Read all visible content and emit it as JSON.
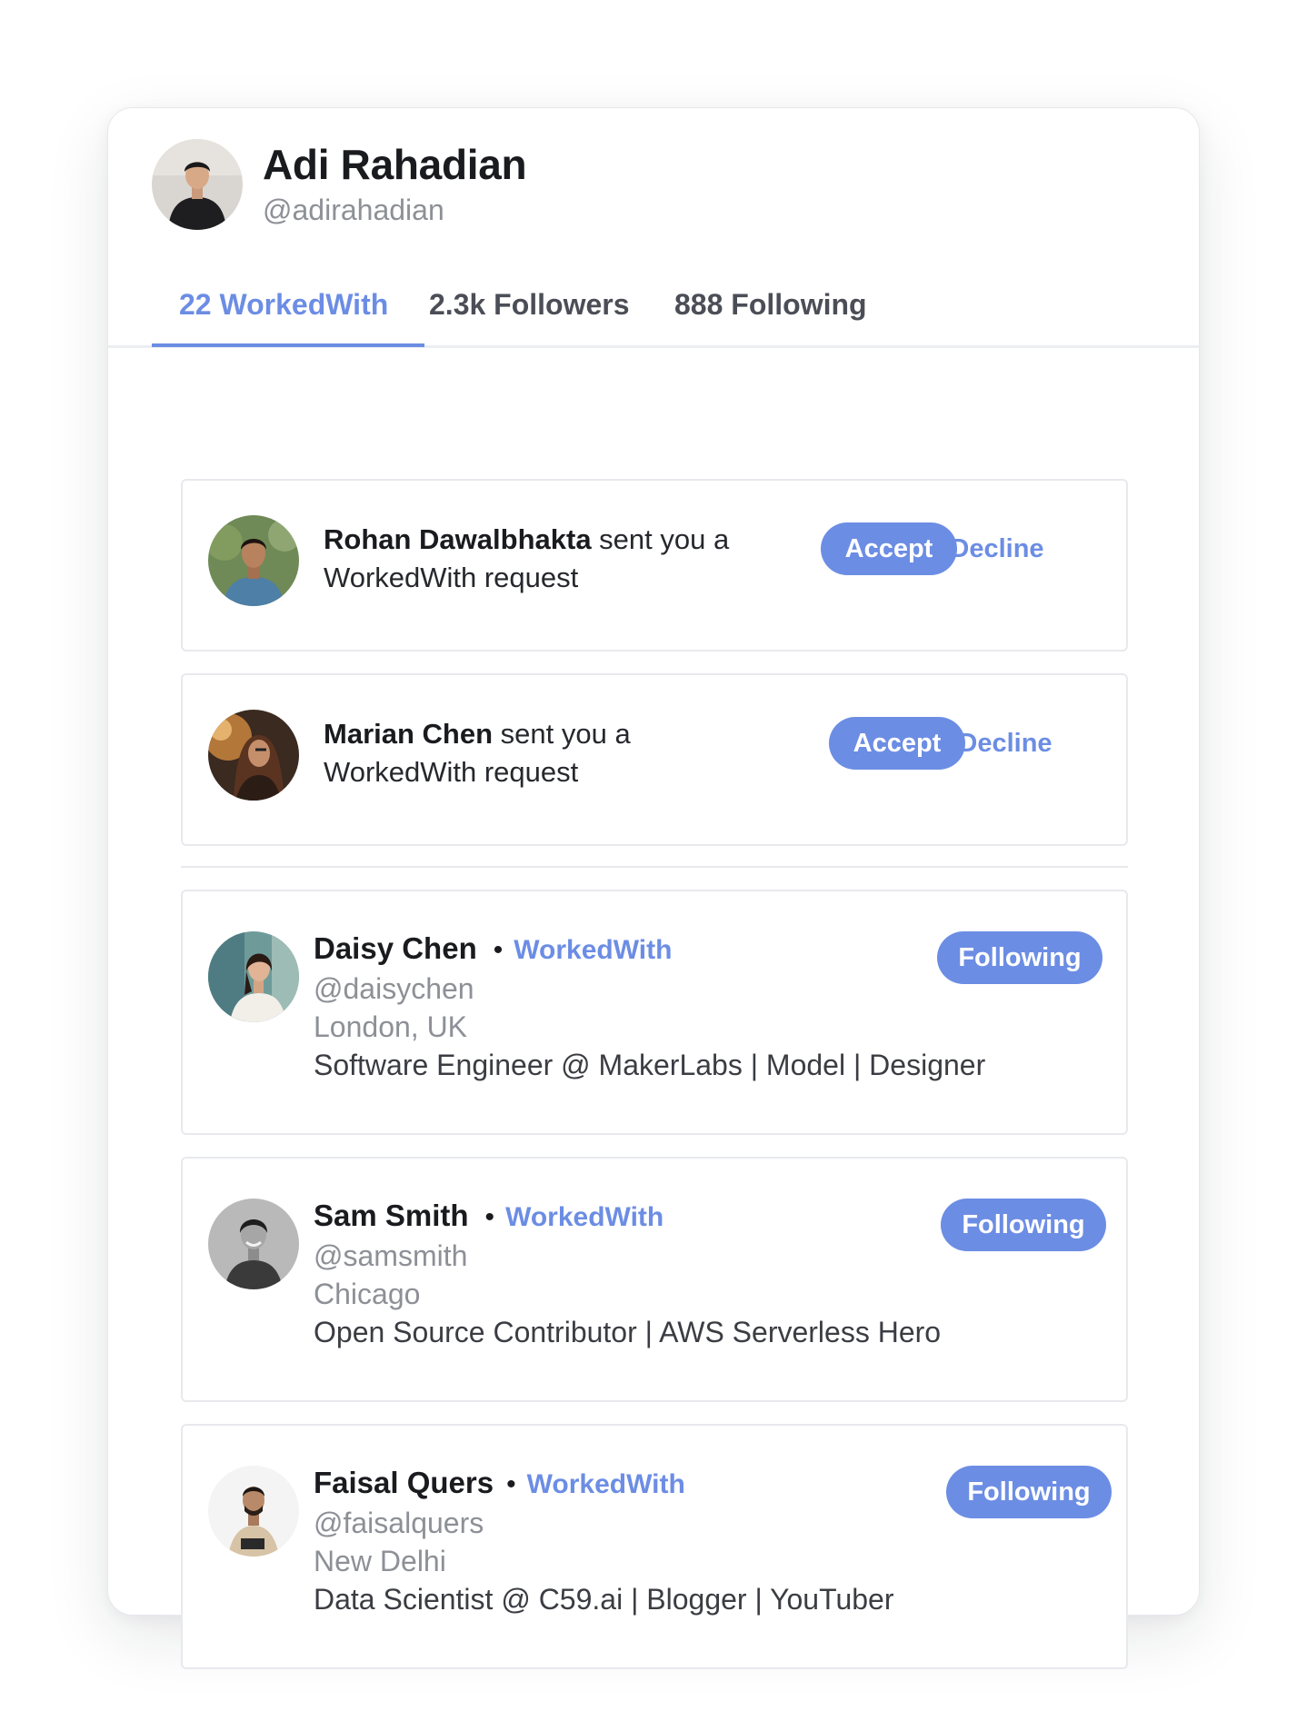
{
  "profile": {
    "name": "Adi Rahadian",
    "handle": "@adirahadian"
  },
  "tabs": [
    {
      "label": "22 WorkedWith",
      "active": true
    },
    {
      "label": "2.3k Followers",
      "active": false
    },
    {
      "label": "888 Following",
      "active": false
    }
  ],
  "requests": [
    {
      "name": "Rohan Dawalbhakta",
      "message": " sent you a WorkedWith request",
      "accept_label": "Accept",
      "decline_label": "Decline"
    },
    {
      "name": "Marian Chen",
      "message": " sent you a WorkedWith request",
      "accept_label": "Accept",
      "decline_label": "Decline"
    }
  ],
  "people": [
    {
      "name": "Daisy Chen",
      "badge": "WorkedWith",
      "handle": "@daisychen",
      "location": "London, UK",
      "bio": "Software Engineer @ MakerLabs | Model | Designer",
      "button_label": "Following"
    },
    {
      "name": "Sam Smith",
      "badge": "WorkedWith",
      "handle": "@samsmith",
      "location": "Chicago",
      "bio": "Open Source Contributor | AWS Serverless Hero",
      "button_label": "Following"
    },
    {
      "name": "Faisal Quers",
      "badge": "WorkedWith",
      "handle": "@faisalquers",
      "location": "New Delhi",
      "bio": "Data Scientist @ C59.ai | Blogger | YouTuber",
      "button_label": "Following"
    }
  ],
  "colors": {
    "accent": "#6c8de4",
    "text_primary": "#1a1b1f",
    "text_muted": "#8d9096",
    "border": "#e8e9ed"
  },
  "separator": "•"
}
